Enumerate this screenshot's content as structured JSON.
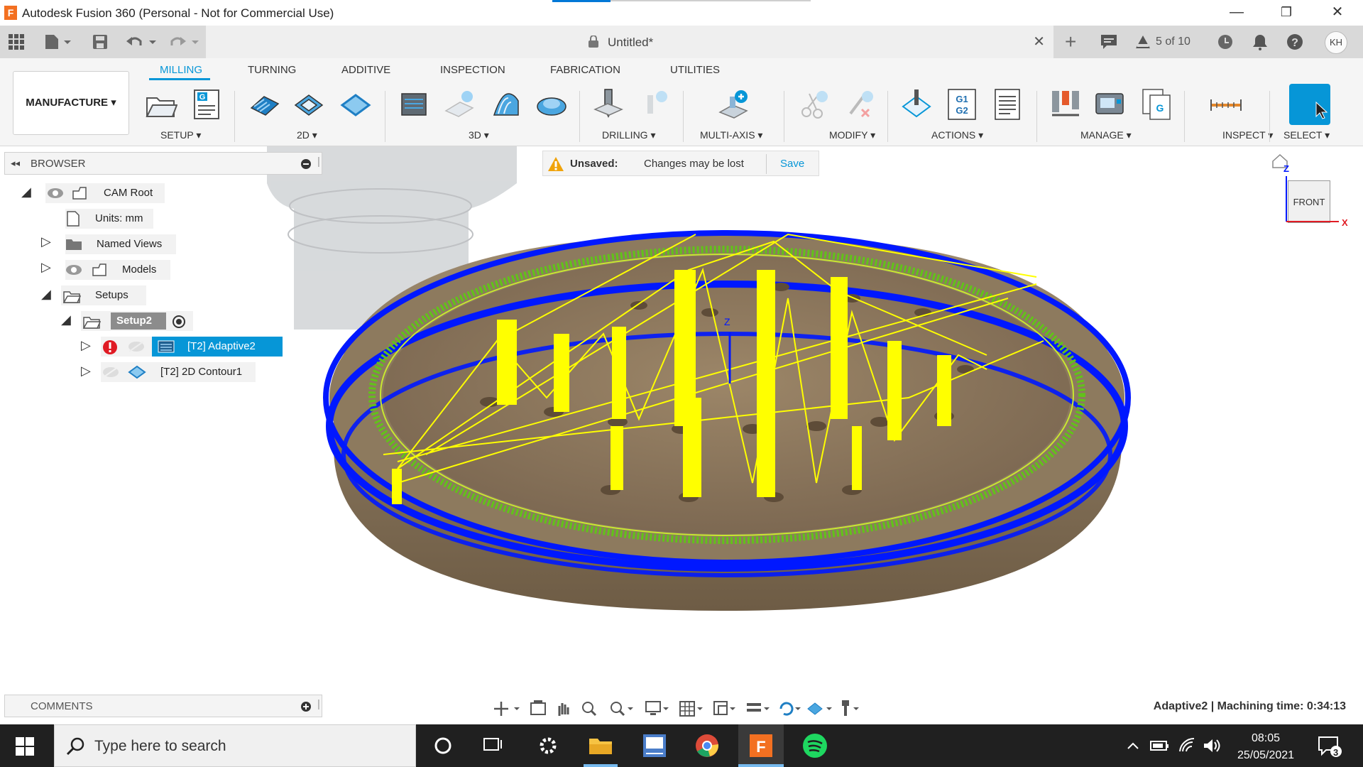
{
  "window": {
    "title": "Autodesk Fusion 360 (Personal - Not for Commercial Use)",
    "logo_letter": "F",
    "minimize": "—",
    "restore": "❐",
    "close": "✕"
  },
  "document": {
    "title": "Untitled*",
    "job_count": "5 of 10",
    "user_initials": "KH"
  },
  "ribbon": {
    "workspace": "MANUFACTURE ▾",
    "tabs": [
      "MILLING",
      "TURNING",
      "ADDITIVE",
      "INSPECTION",
      "FABRICATION",
      "UTILITIES"
    ],
    "groups": [
      "SETUP ▾",
      "2D ▾",
      "3D ▾",
      "DRILLING ▾",
      "MULTI-AXIS ▾",
      "MODIFY ▾",
      "ACTIONS ▾",
      "MANAGE ▾",
      "INSPECT ▾",
      "SELECT ▾"
    ]
  },
  "browser": {
    "title": "BROWSER",
    "nodes": {
      "cam_root": "CAM Root",
      "units": "Units: mm",
      "named_views": "Named Views",
      "models": "Models",
      "setups": "Setups",
      "setup2": "Setup2",
      "adaptive2": "[T2] Adaptive2",
      "contour1": "[T2] 2D Contour1"
    }
  },
  "notice": {
    "label": "Unsaved:",
    "message": "Changes may be lost",
    "action": "Save"
  },
  "viewcube": {
    "face": "FRONT",
    "axis_z": "Z",
    "axis_x": "X"
  },
  "viewport": {
    "triad_z": "Z"
  },
  "comments": {
    "title": "COMMENTS"
  },
  "status": {
    "text": "Adaptive2 | Machining time: 0:34:13"
  },
  "taskbar": {
    "search_placeholder": "Type here to search",
    "time": "08:05",
    "date": "25/05/2021",
    "notifications": "3"
  },
  "colors": {
    "accent": "#0696d7",
    "toolpath_yellow": "#ffff00",
    "toolpath_blue": "#0018ff",
    "stock_brown": "#8a7458",
    "taskbar": "#202020"
  }
}
